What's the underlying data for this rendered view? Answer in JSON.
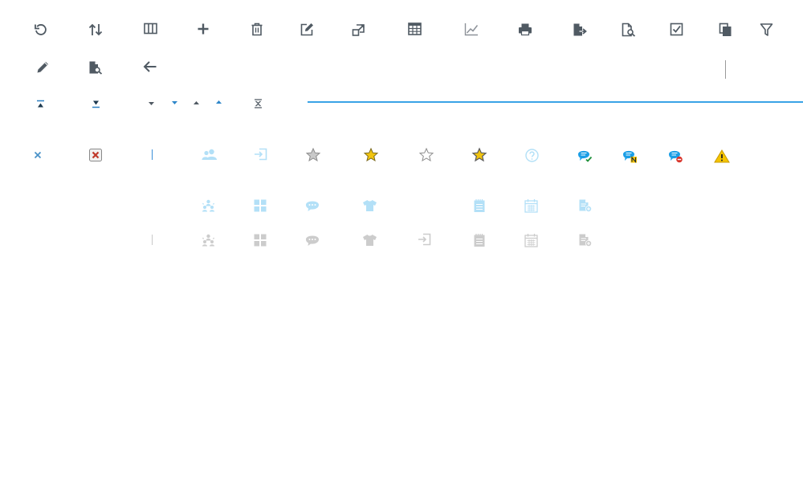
{
  "colors": {
    "toolbar_icon": "#505a63",
    "accent_blue": "#3aa3e6",
    "light_blue": "#b3e0f7",
    "disabled_grey": "#c8c8c8",
    "star_gold": "#f1c40f",
    "warning_yellow": "#f5c400",
    "delete_red": "#c0392b"
  },
  "toolbar": {
    "row1": [
      {
        "name": "refresh-icon",
        "interactable": true
      },
      {
        "name": "sort-icon",
        "interactable": true
      },
      {
        "name": "columns-icon",
        "interactable": true
      },
      {
        "name": "add-icon",
        "interactable": true
      },
      {
        "name": "delete-icon",
        "interactable": true
      },
      {
        "name": "edit-icon",
        "interactable": true
      },
      {
        "name": "expand-icon",
        "interactable": true
      },
      {
        "name": "table-icon",
        "interactable": true
      },
      {
        "name": "line-chart-icon",
        "interactable": true
      },
      {
        "name": "print-icon",
        "interactable": true
      },
      {
        "name": "export-icon",
        "interactable": true
      },
      {
        "name": "preview-icon",
        "interactable": true
      },
      {
        "name": "checkbox-icon",
        "interactable": true
      },
      {
        "name": "copy-icon",
        "interactable": true
      },
      {
        "name": "filter-icon",
        "interactable": true
      }
    ],
    "row2": [
      {
        "name": "pencil-icon",
        "interactable": true
      },
      {
        "name": "document-search-icon",
        "interactable": true
      },
      {
        "name": "back-arrow-icon",
        "interactable": true
      }
    ]
  },
  "sort_controls": [
    {
      "name": "move-top-icon"
    },
    {
      "name": "move-bottom-icon"
    },
    {
      "name": "caret-down-grey-icon"
    },
    {
      "name": "caret-down-blue-icon"
    },
    {
      "name": "caret-up-grey-icon"
    },
    {
      "name": "caret-up-blue-icon"
    },
    {
      "name": "collapse-icon"
    }
  ],
  "status_icons": [
    {
      "name": "close-icon"
    },
    {
      "name": "close-box-icon"
    },
    {
      "name": "text-cursor-icon"
    },
    {
      "name": "users-icon"
    },
    {
      "name": "login-icon"
    },
    {
      "name": "star-grey-icon"
    },
    {
      "name": "star-gold-icon"
    },
    {
      "name": "star-outline-icon"
    },
    {
      "name": "star-gold-outline-icon"
    },
    {
      "name": "help-icon"
    },
    {
      "name": "comment-check-icon"
    },
    {
      "name": "comment-new-icon"
    },
    {
      "name": "comment-blocked-icon"
    },
    {
      "name": "warning-icon"
    }
  ],
  "light_icons": [
    {
      "name": "team-icon"
    },
    {
      "name": "dashboard-grid-icon"
    },
    {
      "name": "chat-bubble-icon"
    },
    {
      "name": "tshirt-icon"
    },
    {
      "name": "notepad-icon"
    },
    {
      "name": "calendar-icon"
    },
    {
      "name": "document-add-icon"
    }
  ],
  "disabled_icons": [
    {
      "name": "text-cursor-icon"
    },
    {
      "name": "team-icon"
    },
    {
      "name": "dashboard-grid-icon"
    },
    {
      "name": "chat-bubble-icon"
    },
    {
      "name": "tshirt-icon"
    },
    {
      "name": "login-icon"
    },
    {
      "name": "notepad-icon"
    },
    {
      "name": "calendar-icon"
    },
    {
      "name": "document-add-icon"
    }
  ]
}
